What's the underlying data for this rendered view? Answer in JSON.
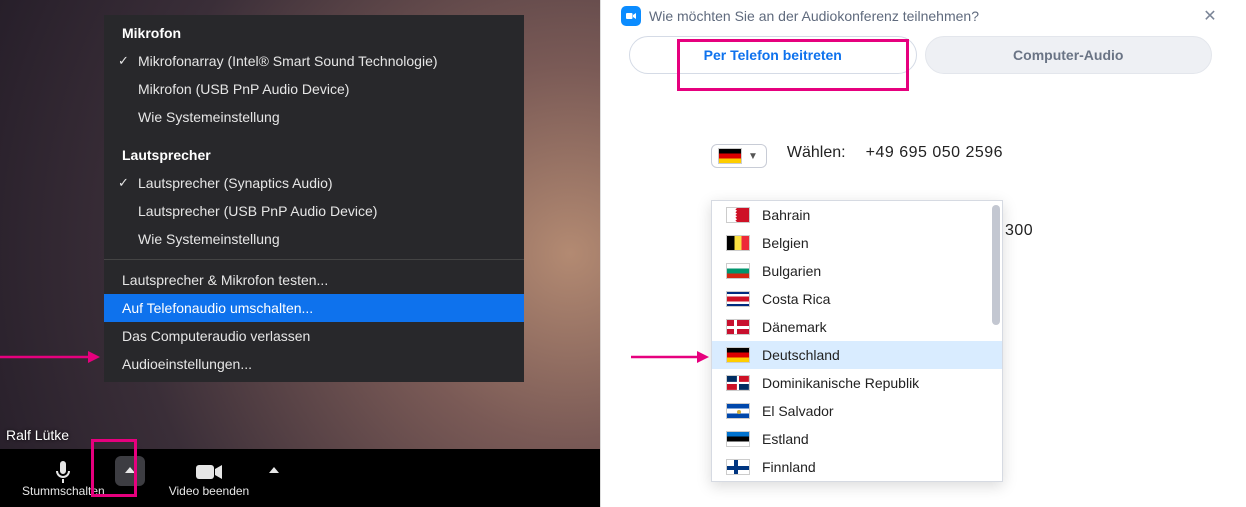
{
  "left": {
    "user_name": "Ralf Lütke",
    "menu": {
      "mic_title": "Mikrofon",
      "mic_items": [
        "Mikrofonarray (Intel® Smart Sound Technologie)",
        "Mikrofon (USB PnP Audio Device)",
        "Wie Systemeinstellung"
      ],
      "spk_title": "Lautsprecher",
      "spk_items": [
        "Lautsprecher (Synaptics Audio)",
        "Lautsprecher (USB PnP Audio Device)",
        "Wie Systemeinstellung"
      ],
      "test_label": "Lautsprecher & Mikrofon testen...",
      "switch_phone_label": "Auf Telefonaudio umschalten...",
      "leave_audio_label": "Das Computeraudio verlassen",
      "audio_settings_label": "Audioeinstellungen..."
    },
    "toolbar": {
      "mute_label": "Stummschalten",
      "video_label": "Video beenden"
    }
  },
  "right": {
    "title": "Wie möchten Sie an der Audiokonferenz teilnehmen?",
    "tab_phone": "Per Telefon beitreten",
    "tab_computer": "Computer-Audio",
    "dial_label": "Wählen:",
    "phone1": "+49 695 050 2596",
    "phone3_suffix": "300",
    "countries": [
      {
        "name": "Bahrain",
        "flag": "flag-bh"
      },
      {
        "name": "Belgien",
        "flag": "flag-be"
      },
      {
        "name": "Bulgarien",
        "flag": "flag-bg"
      },
      {
        "name": "Costa Rica",
        "flag": "flag-cr"
      },
      {
        "name": "Dänemark",
        "flag": "flag-dk"
      },
      {
        "name": "Deutschland",
        "flag": "flag-de"
      },
      {
        "name": "Dominikanische Republik",
        "flag": "flag-do"
      },
      {
        "name": "El Salvador",
        "flag": "flag-sv"
      },
      {
        "name": "Estland",
        "flag": "flag-ee"
      },
      {
        "name": "Finnland",
        "flag": "flag-fi"
      }
    ],
    "selected_country_index": 5
  }
}
